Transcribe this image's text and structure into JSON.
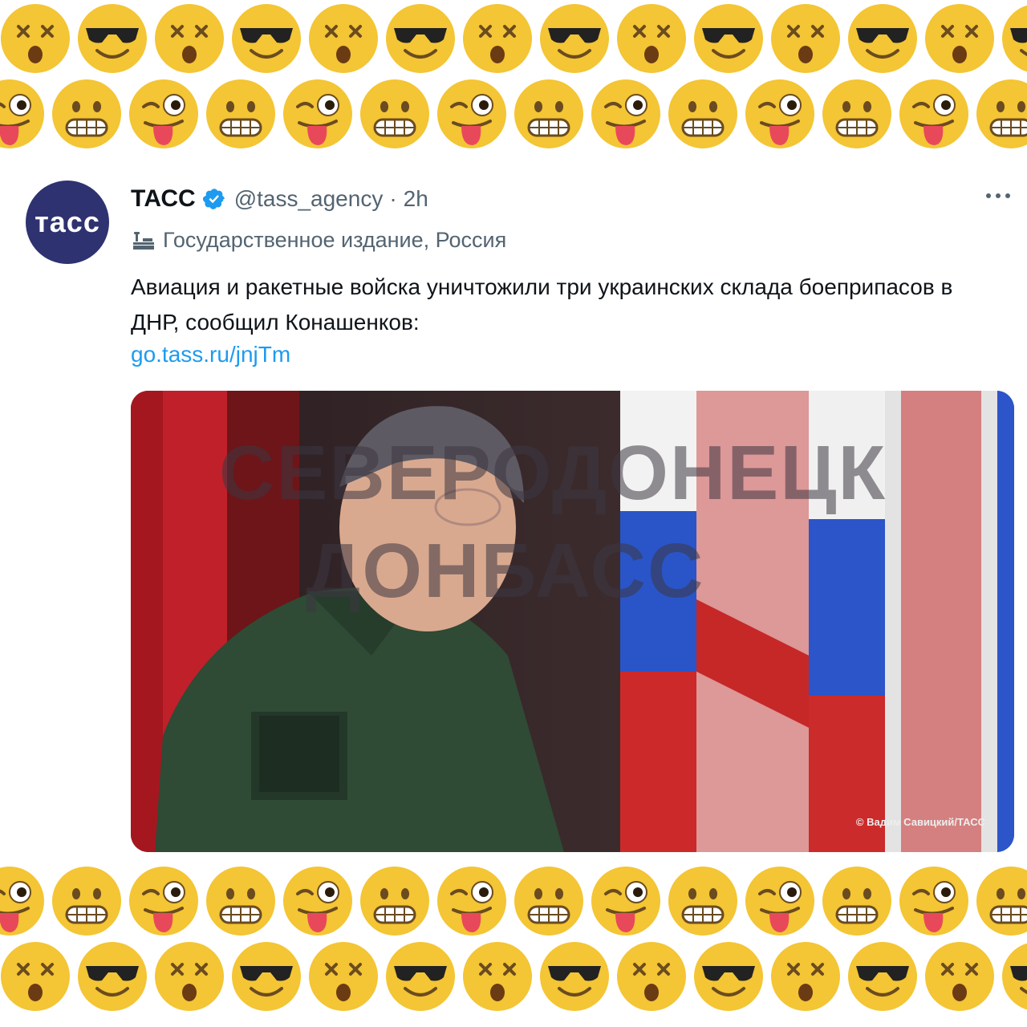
{
  "tweet": {
    "author_name": "ТАСС",
    "avatar_text": "тасс",
    "handle": "@tass_agency",
    "separator": "·",
    "time": "2h",
    "label": "Государственное издание, Россия",
    "text": "Авиация и ракетные войска уничтожили три украинских склада боеприпасов в ДНР, сообщил Конашенков:",
    "link": "go.tass.ru/jnjTm",
    "media": {
      "watermark_line1": "СЕВЕРОДОНЕЦК",
      "watermark_line2": "ДОНБАСС",
      "credit": "© Вадим Савицкий/ТАСС"
    }
  },
  "colors": {
    "verified": "#1d9bf0",
    "link": "#1d9bf0",
    "avatar_bg": "#2e3270",
    "emoji": "#f4c534"
  },
  "emoji_rows": [
    [
      "dizzy-face",
      "sunglasses-face"
    ],
    [
      "winking-tongue-face",
      "grimacing-face"
    ],
    [
      "winking-tongue-face",
      "grimacing-face"
    ],
    [
      "dizzy-face",
      "sunglasses-face"
    ]
  ]
}
